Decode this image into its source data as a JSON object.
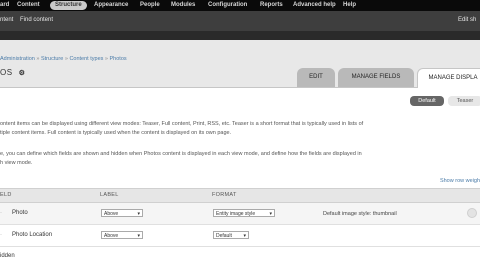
{
  "toolbar": {
    "items": [
      "ard",
      "Content",
      "Structure",
      "Appearance",
      "People",
      "Modules",
      "Configuration",
      "Reports",
      "Advanced help",
      "Help"
    ]
  },
  "shortcuts": {
    "left": [
      "ntent",
      "Find content"
    ],
    "right": "Edit sh"
  },
  "breadcrumb": [
    "Administration",
    "Structure",
    "Content types",
    "Photos"
  ],
  "page": {
    "title": "OS",
    "gear": "⚙"
  },
  "tabs": [
    "EDIT",
    "MANAGE FIELDS",
    "MANAGE DISPLA"
  ],
  "view_modes": [
    "Default",
    "Teaser"
  ],
  "description": {
    "line1": "ontent items can be displayed using different view modes: Teaser, Full content, Print, RSS, etc. Teaser is a short format that is typically used in lists of",
    "line2": "tiple content items. Full content is typically used when the content is displayed on its own page.",
    "line3": "e, you can define which fields are shown and hidden when Photos content is displayed in each view mode, and define how the fields are displayed in",
    "line4": "h view mode."
  },
  "show_row_weights": "Show row weigh",
  "table": {
    "headers": [
      "ELD",
      "LABEL",
      "FORMAT"
    ],
    "rows": [
      {
        "name": "Photo",
        "label": "Above",
        "format": "Entity image style",
        "summary": "Default image style: thumbnail"
      },
      {
        "name": "Photo Location",
        "label": "Above",
        "format": "Default",
        "summary": ""
      }
    ]
  },
  "hidden_region": "idden"
}
